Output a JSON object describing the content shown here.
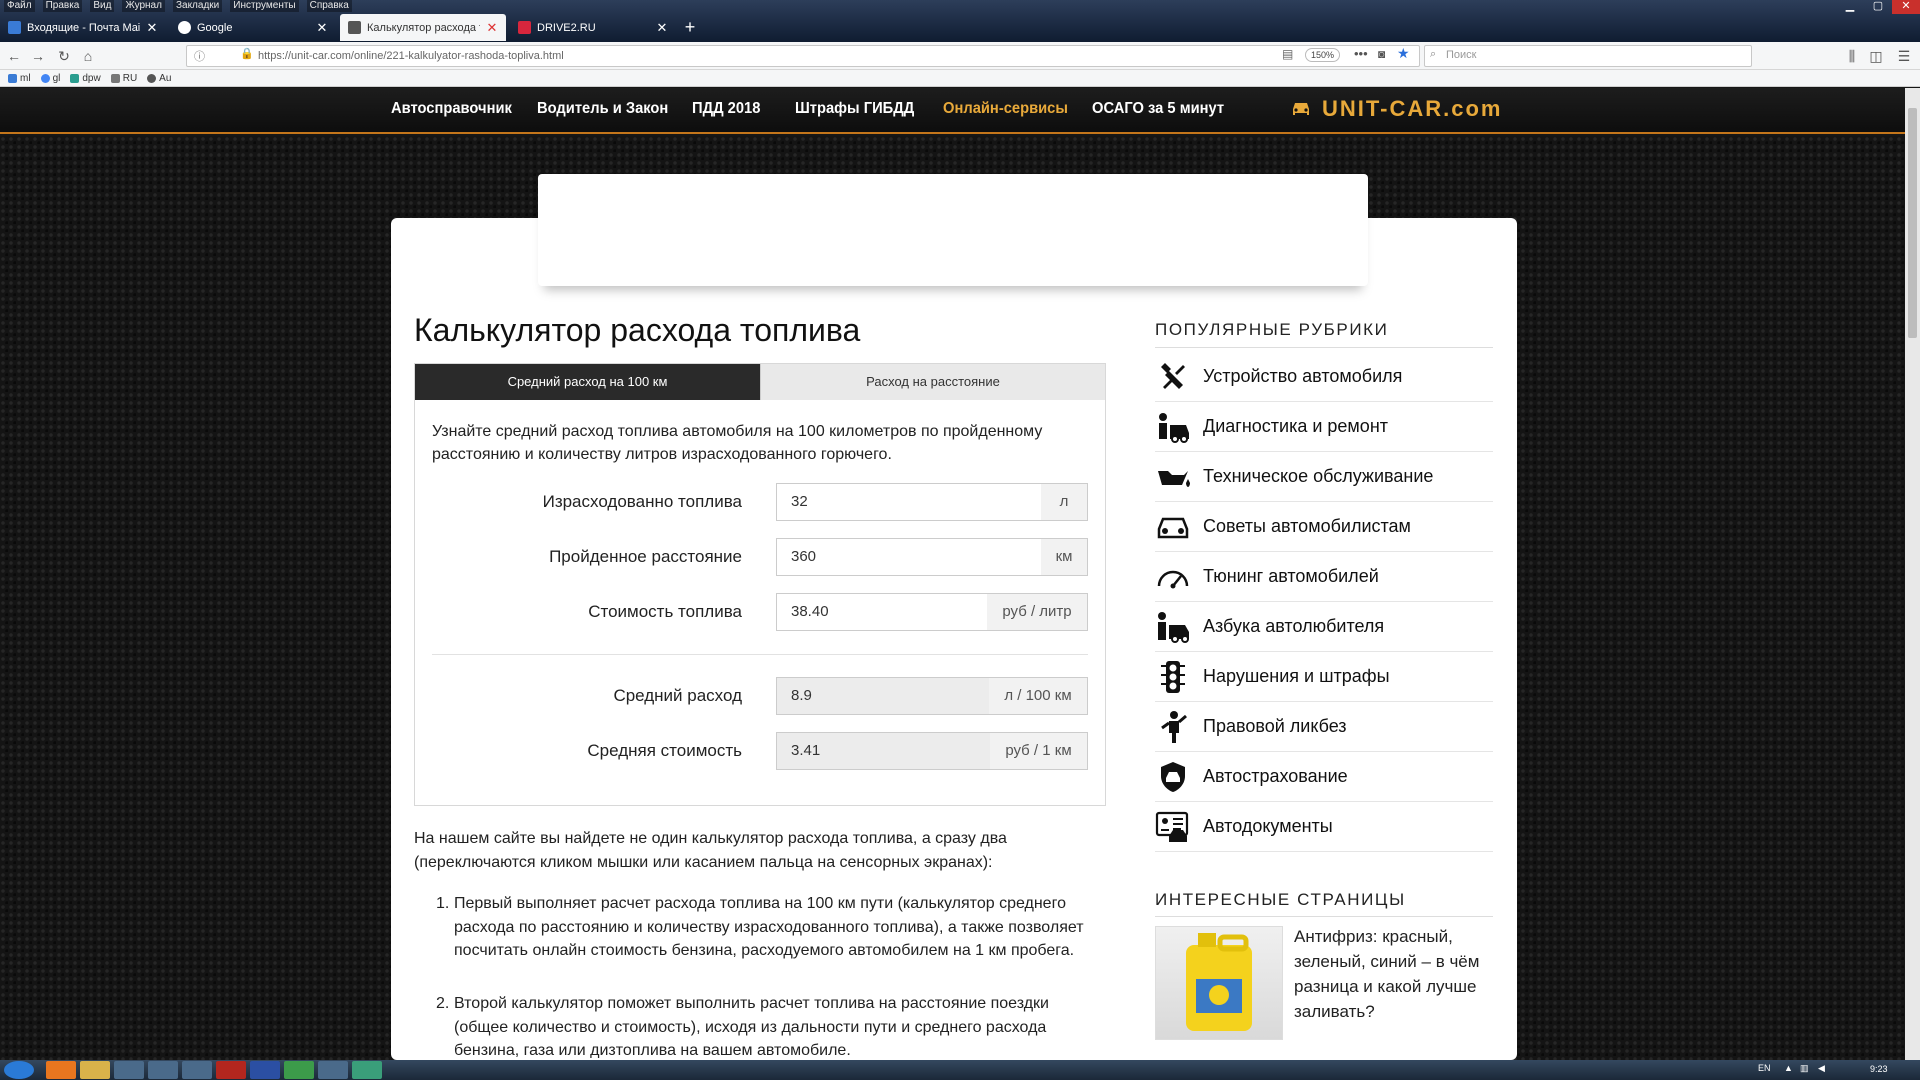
{
  "browser": {
    "menu": [
      "Файл",
      "Правка",
      "Вид",
      "Журнал",
      "Закладки",
      "Инструменты",
      "Справка"
    ],
    "tabs": [
      {
        "title": "Входящие - Почта Mail.Ru",
        "color": "#3a7bd5"
      },
      {
        "title": "Google",
        "color": "#ffffff"
      },
      {
        "title": "Калькулятор расхода топлива",
        "color": "#555555"
      },
      {
        "title": "DRIVE2.RU",
        "color": "#d7263d"
      }
    ],
    "url": "https://unit-car.com/online/221-kalkulyator-rashoda-topliva.html",
    "zoom": "150%",
    "search_placeholder": "Поиск",
    "bookmarks": [
      "ml",
      "gl",
      "dpw",
      "RU",
      "Au"
    ]
  },
  "site": {
    "nav": [
      "Автосправочник",
      "Водитель и Закон",
      "ПДД 2018",
      "Штрафы ГИБДД",
      "Онлайн-сервисы",
      "ОСАГО за 5 минут"
    ],
    "nav_active_index": 4,
    "logo": "UNIT-CAR.com",
    "accent": "#e8a93a"
  },
  "page": {
    "title": "Калькулятор расхода топлива",
    "tabs": [
      "Средний расход на 100 км",
      "Расход на расстояние"
    ],
    "intro": "Узнайте средний расход топлива автомобиля на 100 километров по пройденному расстоянию и количеству литров израсходованного горючего.",
    "fields": [
      {
        "label": "Израсходованно топлива",
        "value": "32",
        "unit": "л"
      },
      {
        "label": "Пройденное расстояние",
        "value": "360",
        "unit": "км"
      },
      {
        "label": "Стоимость топлива",
        "value": "38.40",
        "unit": "руб / литр"
      }
    ],
    "results": [
      {
        "label": "Средний расход",
        "value": "8.9",
        "unit": "л / 100 км"
      },
      {
        "label": "Средняя стоимость",
        "value": "3.41",
        "unit": "руб / 1 км"
      }
    ],
    "article_intro": "На нашем сайте вы найдете не один калькулятор расхода топлива, а сразу два (переключаются кликом мышки или касанием пальца на сенсорных экранах):",
    "list": [
      "Первый выполняет расчет расхода топлива на 100 км пути (калькулятор среднего расхода по расстоянию и количеству израсходованного топлива), а также позволяет посчитать онлайн стоимость бензина, расходуемого автомобилем на 1 км пробега.",
      "Второй калькулятор поможет выполнить расчет топлива на расстояние поездки (общее количество и стоимость), исходя из дальности пути и среднего расхода бензина, газа или дизтоплива на вашем автомобиле."
    ]
  },
  "sidebar": {
    "popular_title": "ПОПУЛЯРНЫЕ РУБРИКИ",
    "items": [
      {
        "label": "Устройство автомобиля",
        "icon": "tools-icon"
      },
      {
        "label": "Диагностика и ремонт",
        "icon": "mechanic-icon"
      },
      {
        "label": "Техническое обслуживание",
        "icon": "oil-can-icon"
      },
      {
        "label": "Советы автомобилистам",
        "icon": "car-advice-icon"
      },
      {
        "label": "Тюнинг автомобилей",
        "icon": "speedometer-icon"
      },
      {
        "label": "Азбука автолюбителя",
        "icon": "driver-icon"
      },
      {
        "label": "Нарушения и штрафы",
        "icon": "traffic-light-icon"
      },
      {
        "label": "Правовой ликбез",
        "icon": "police-icon"
      },
      {
        "label": "Автострахование",
        "icon": "insurance-icon"
      },
      {
        "label": "Автодокументы",
        "icon": "documents-icon"
      }
    ],
    "interesting_title": "ИНТЕРЕСНЫЕ СТРАНИЦЫ",
    "interesting_text": "Антифриз: красный, зеленый, синий – в чём разница и какой лучше заливать?"
  },
  "taskbar": {
    "lang": "EN",
    "clock": "9:23"
  }
}
